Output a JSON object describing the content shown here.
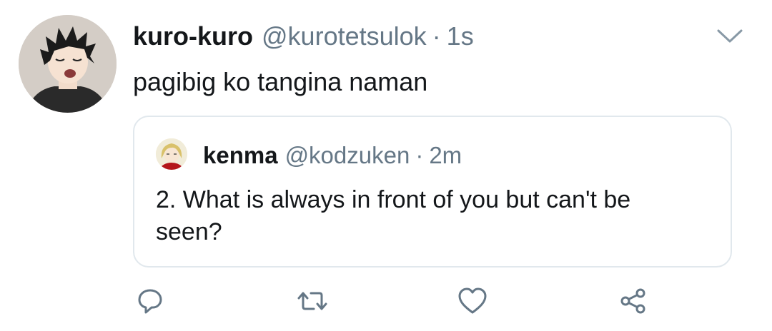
{
  "tweet": {
    "author": {
      "display_name": "kuro-kuro",
      "handle": "@kurotetsulok",
      "avatar": "avatar-kuroo"
    },
    "separator": "·",
    "time": "1s",
    "text": "pagibig ko tangina naman",
    "menu_icon": "chevron-down-icon"
  },
  "quoted_tweet": {
    "author": {
      "display_name": "kenma",
      "handle": "@kodzuken",
      "avatar": "avatar-kenma"
    },
    "separator": "·",
    "time": "2m",
    "text": "2. What is always in front of you but can't be seen?"
  },
  "actions": [
    {
      "name": "reply",
      "icon": "reply-icon"
    },
    {
      "name": "retweet",
      "icon": "retweet-icon"
    },
    {
      "name": "like",
      "icon": "heart-icon"
    },
    {
      "name": "share",
      "icon": "share-icon"
    }
  ],
  "colors": {
    "text_primary": "#14171a",
    "text_secondary": "#657786",
    "border": "#e1e8ed",
    "icon": "#657786"
  }
}
